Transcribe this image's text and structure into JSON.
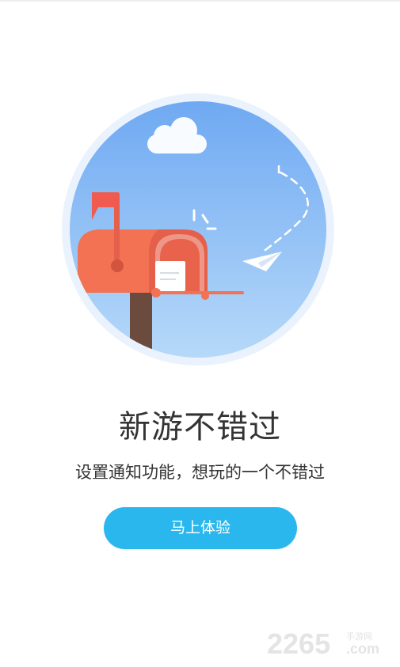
{
  "colors": {
    "accent": "#2ab7ee",
    "headline_text": "#333333",
    "sky_top": "#6fa9f2",
    "sky_bottom": "#a9d2f8",
    "mailbox": "#f37254",
    "flag": "#f15a4f"
  },
  "content": {
    "headline": "新游不错过",
    "subtitle": "设置通知功能，想玩的一个不错过",
    "cta_label": "马上体验"
  },
  "watermark": {
    "number": "2265",
    "site_cn": "手游网",
    "site_domain": ".com"
  },
  "icons": {
    "illustration": "mailbox-paper-plane-illustration"
  }
}
